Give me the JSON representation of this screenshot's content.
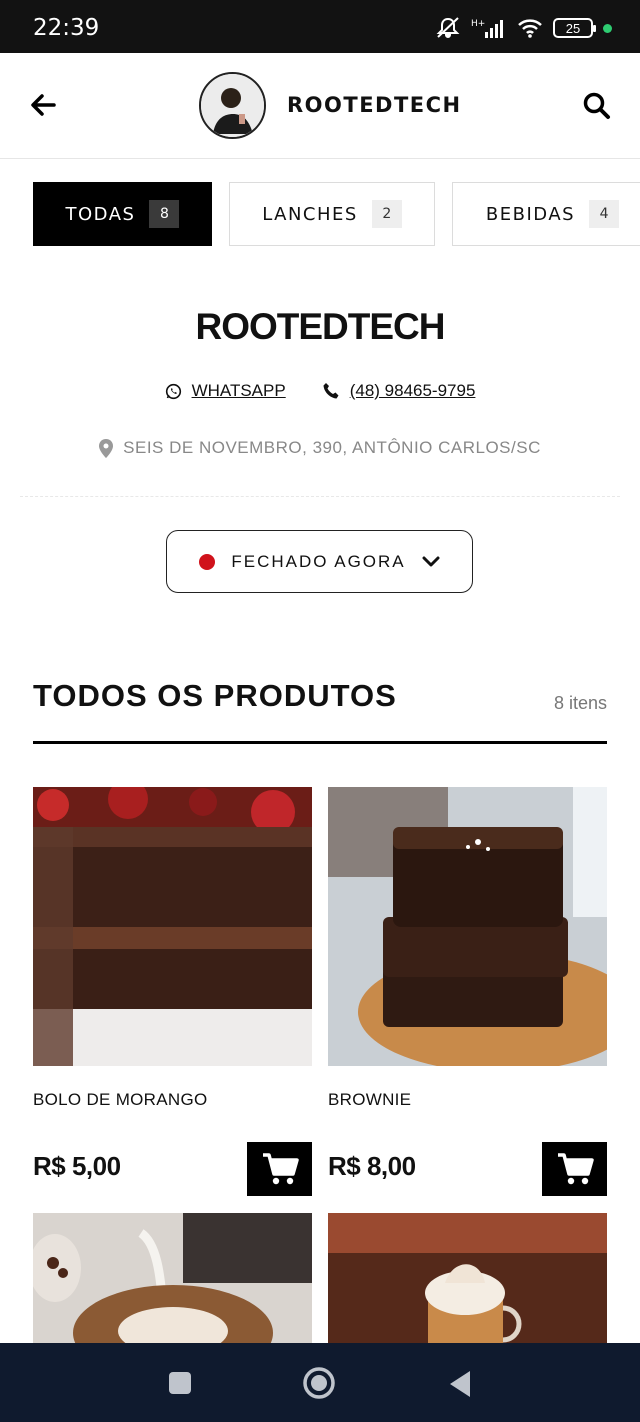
{
  "status_bar": {
    "time": "22:39",
    "battery": "25"
  },
  "header": {
    "title": "ROOTEDTECH"
  },
  "tabs": [
    {
      "label": "TODAS",
      "count": "8",
      "active": true
    },
    {
      "label": "LANCHES",
      "count": "2",
      "active": false
    },
    {
      "label": "BEBIDAS",
      "count": "4",
      "active": false
    }
  ],
  "store": {
    "name": "ROOTEDTECH",
    "whatsapp_label": "WHATSAPP",
    "phone": "(48) 98465-9795",
    "address": "SEIS DE NOVEMBRO, 390, ANTÔNIO CARLOS/SC",
    "status": "FECHADO AGORA",
    "status_color": "#d0121b"
  },
  "products_section": {
    "title": "TODOS OS PRODUTOS",
    "count": "8 itens"
  },
  "products": [
    {
      "name": "BOLO DE MORANGO",
      "price": "R$ 5,00",
      "image": "chocolate-cake"
    },
    {
      "name": "BROWNIE",
      "price": "R$ 8,00",
      "image": "brownie"
    },
    {
      "name": "",
      "price": "",
      "image": "latte-art"
    },
    {
      "name": "",
      "price": "",
      "image": "cappuccino-whipped-cream"
    }
  ]
}
